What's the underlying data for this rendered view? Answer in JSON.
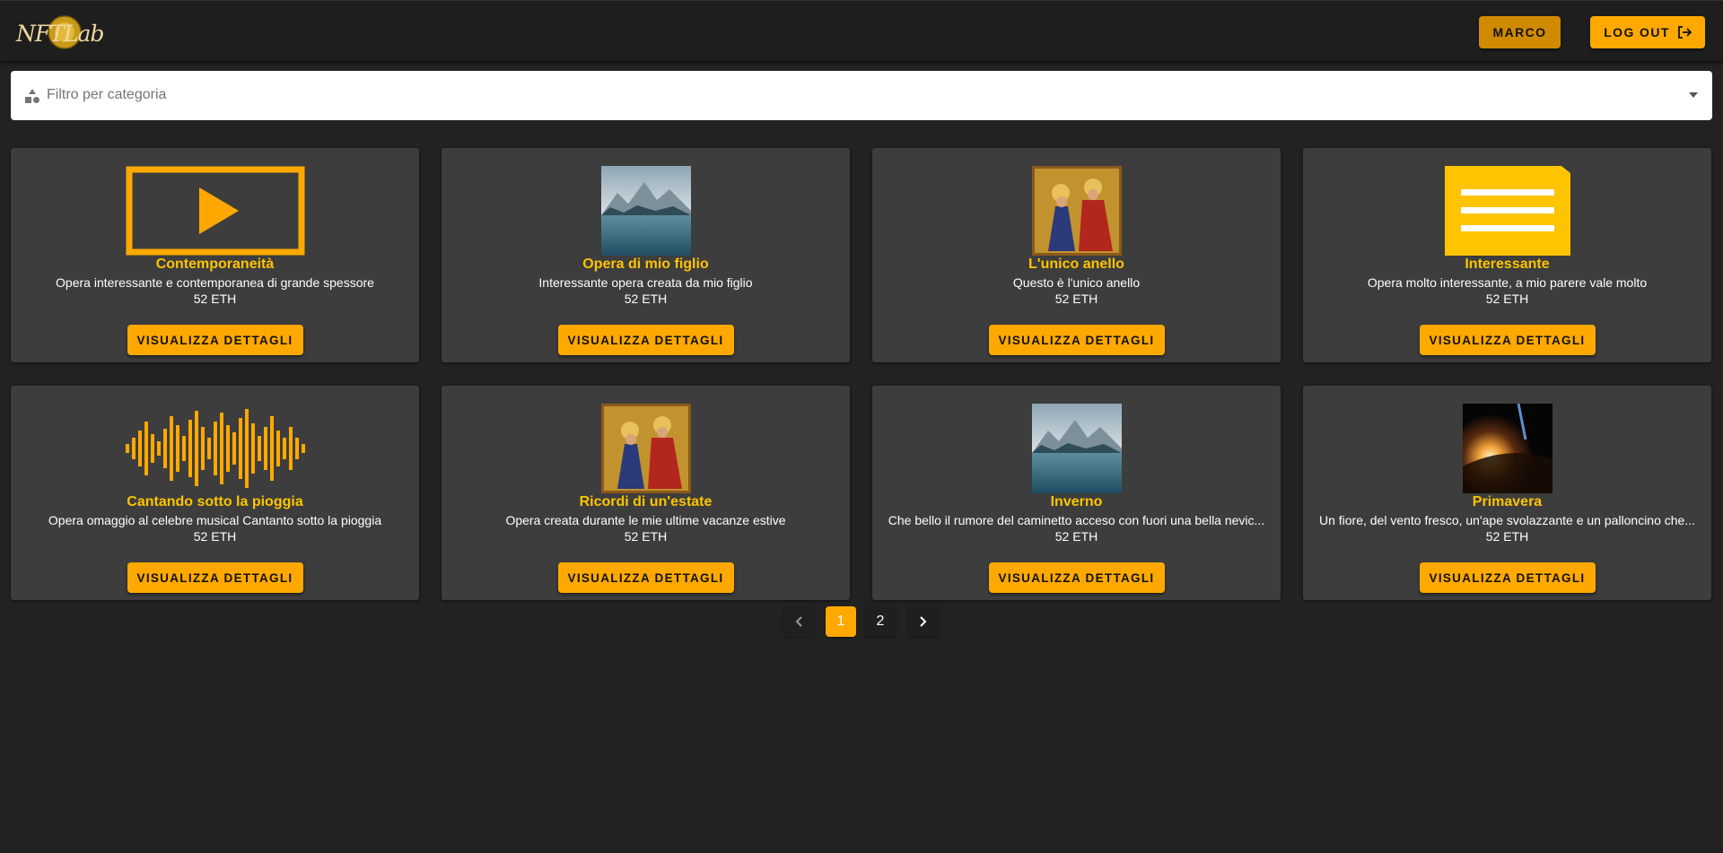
{
  "header": {
    "logo_text": "NFTLab",
    "user_button": "MARCO",
    "logout_button": "LOG OUT",
    "logout_icon": "logout-icon"
  },
  "filter": {
    "placeholder": "Filtro per categoria",
    "icon": "category-icon",
    "arrow_icon": "chevron-down-icon"
  },
  "colors": {
    "accent": "#ffa900",
    "title": "#ffc400",
    "card_bg": "#3d3d3d",
    "page_bg": "#222222"
  },
  "cards": [
    {
      "title": "Contemporaneità",
      "description": "Opera interessante e contemporanea di grande spessore",
      "price": "52 ETH",
      "button": "VISUALIZZA DETTAGLI",
      "thumb": "video-icon"
    },
    {
      "title": "Opera di mio figlio",
      "description": "Interessante opera creata da mio figlio",
      "price": "52 ETH",
      "button": "VISUALIZZA DETTAGLI",
      "thumb": "lake-image"
    },
    {
      "title": "L'unico anello",
      "description": "Questo è l'unico anello",
      "price": "52 ETH",
      "button": "VISUALIZZA DETTAGLI",
      "thumb": "painting-image"
    },
    {
      "title": "Interessante",
      "description": "Opera molto interessante, a mio parere vale molto",
      "price": "52 ETH",
      "button": "VISUALIZZA DETTAGLI",
      "thumb": "document-icon"
    },
    {
      "title": "Cantando sotto la pioggia",
      "description": "Opera omaggio al celebre musical Cantanto sotto la pioggia",
      "price": "52 ETH",
      "button": "VISUALIZZA DETTAGLI",
      "thumb": "audio-wave-icon"
    },
    {
      "title": "Ricordi di un'estate",
      "description": "Opera creata durante le mie ultime vacanze estive",
      "price": "52 ETH",
      "button": "VISUALIZZA DETTAGLI",
      "thumb": "painting-image"
    },
    {
      "title": "Inverno",
      "description": "Che bello il rumore del caminetto acceso con fuori una bella nevic...",
      "price": "52 ETH",
      "button": "VISUALIZZA DETTAGLI",
      "thumb": "lake-image"
    },
    {
      "title": "Primavera",
      "description": "Un fiore, del vento fresco, un'ape svolazzante e un palloncino che...",
      "price": "52 ETH",
      "button": "VISUALIZZA DETTAGLI",
      "thumb": "space-image"
    }
  ],
  "pagination": {
    "prev_icon": "chevron-left-icon",
    "pages": [
      "1",
      "2"
    ],
    "current": "1",
    "next_icon": "chevron-right-icon"
  }
}
